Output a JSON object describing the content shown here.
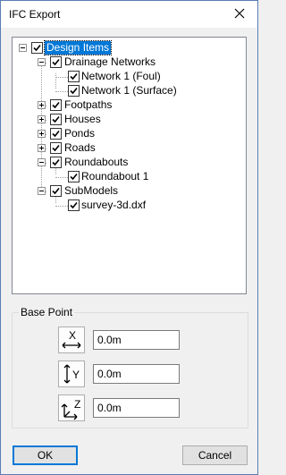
{
  "window": {
    "title": "IFC Export"
  },
  "tree": {
    "root": {
      "label": "Design Items",
      "checked": true
    },
    "drainage": {
      "label": "Drainage Networks",
      "checked": true
    },
    "network_foul": {
      "label": "Network 1 (Foul)",
      "checked": true
    },
    "network_surface": {
      "label": "Network 1 (Surface)",
      "checked": true
    },
    "footpaths": {
      "label": "Footpaths",
      "checked": true
    },
    "houses": {
      "label": "Houses",
      "checked": true
    },
    "ponds": {
      "label": "Ponds",
      "checked": true
    },
    "roads": {
      "label": "Roads",
      "checked": true
    },
    "roundabouts": {
      "label": "Roundabouts",
      "checked": true
    },
    "roundabout1": {
      "label": "Roundabout 1",
      "checked": true
    },
    "submodels": {
      "label": "SubModels",
      "checked": true
    },
    "survey": {
      "label": "survey-3d.dxf",
      "checked": true
    }
  },
  "base_point": {
    "label": "Base Point",
    "x_value": "0.0m",
    "y_value": "0.0m",
    "z_value": "0.0m",
    "x_axis": "X",
    "y_axis": "Y",
    "z_axis": "Z"
  },
  "buttons": {
    "ok": "OK",
    "cancel": "Cancel"
  },
  "icons": {
    "close": "close-icon",
    "check": "checkmark-icon"
  },
  "colors": {
    "selection": "#0078d7",
    "default_button_border": "#0078d7"
  }
}
